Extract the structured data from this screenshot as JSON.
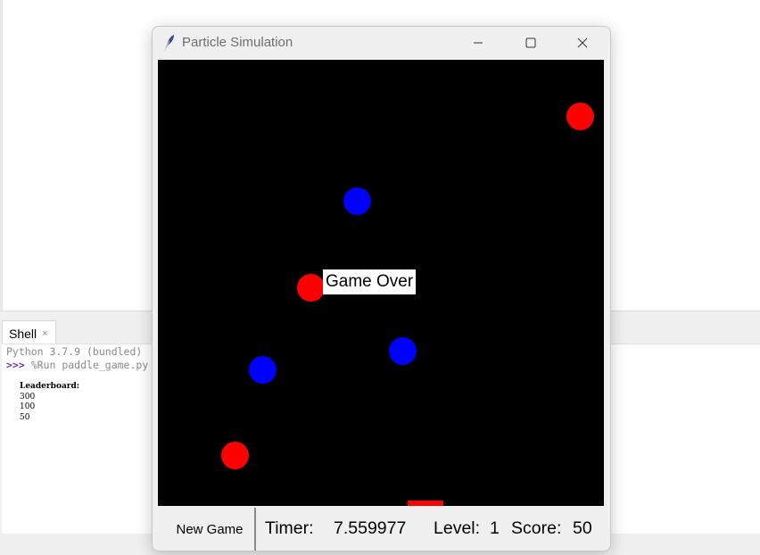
{
  "ide": {
    "shell_tab": {
      "label": "Shell",
      "close": "×"
    },
    "shell": {
      "line1": "Python 3.7.9 (bundled)",
      "prompt": ">>>",
      "command": " %Run paddle_game.py",
      "leaderboard_title": "Leaderboard:",
      "scores": [
        "300",
        "100",
        "50"
      ]
    }
  },
  "window": {
    "title": "Particle Simulation",
    "icon": "feather-icon",
    "controls": {
      "minimize": "minimize-icon",
      "maximize": "maximize-icon",
      "close": "close-icon"
    }
  },
  "game": {
    "overlay_text": "Game Over",
    "colors": {
      "canvas": "#000000",
      "particle_red": "#ff0000",
      "particle_blue": "#0000ff",
      "paddle": "#ff0000"
    }
  },
  "controls": {
    "new_game": "New Game",
    "timer_label": "Timer:",
    "timer_value": "7.559977",
    "level_label": "Level:",
    "level_value": "1",
    "score_label": "Score:",
    "score_value": "50"
  }
}
